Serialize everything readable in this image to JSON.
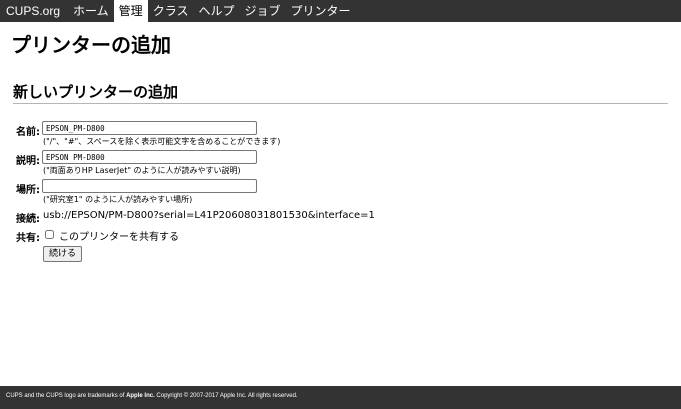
{
  "nav": {
    "brand": "CUPS.org",
    "items": [
      {
        "label": "ホーム"
      },
      {
        "label": "管理"
      },
      {
        "label": "クラス"
      },
      {
        "label": "ヘルプ"
      },
      {
        "label": "ジョブ"
      },
      {
        "label": "プリンター"
      }
    ],
    "active_label": "管理"
  },
  "page_title": "プリンターの追加",
  "section_title": "新しいプリンターの追加",
  "form": {
    "name": {
      "label": "名前:",
      "value": "EPSON_PM-D800",
      "hint": "(\"/\"、\"#\"、スペースを除く表示可能文字を含めることができます)"
    },
    "description": {
      "label": "説明:",
      "value": "EPSON PM-D800",
      "hint": "(\"両面ありHP LaserJet\" のように人が読みやすい説明)"
    },
    "location": {
      "label": "場所:",
      "value": "",
      "hint": "(\"研究室1\" のように人が読みやすい場所)"
    },
    "connection": {
      "label": "接続:",
      "value": "usb://EPSON/PM-D800?serial=L41P20608031801530&interface=1"
    },
    "sharing": {
      "label": "共有:",
      "checkbox_label": "このプリンターを共有する",
      "checked": false
    },
    "continue_label": "続ける"
  },
  "footer": {
    "prefix": "CUPS and the CUPS logo are trademarks of ",
    "company": "Apple Inc.",
    "suffix": " Copyright © 2007-2017 Apple Inc. All rights reserved."
  }
}
